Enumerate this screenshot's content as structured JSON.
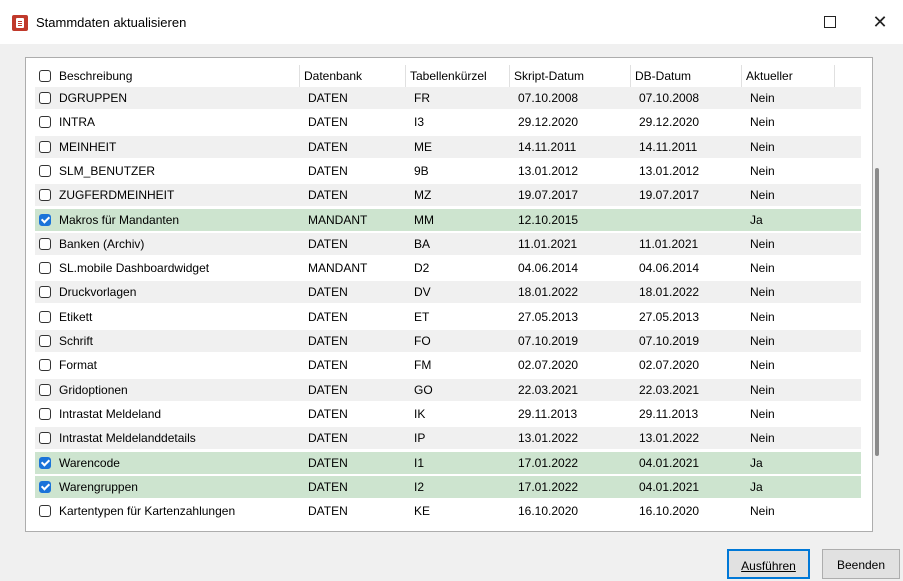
{
  "window": {
    "title": "Stammdaten aktualisieren",
    "close_glyph": "✕"
  },
  "grid": {
    "columns": [
      "Beschreibung",
      "Datenbank",
      "Tabellenkürzel",
      "Skript-Datum",
      "DB-Datum",
      "Aktueller"
    ],
    "rows": [
      {
        "checked": false,
        "beschreibung": "DGRUPPEN",
        "datenbank": "DATEN",
        "kuerzel": "FR",
        "skript": "07.10.2008",
        "db": "07.10.2008",
        "aktuell": "Nein"
      },
      {
        "checked": false,
        "beschreibung": "INTRA",
        "datenbank": "DATEN",
        "kuerzel": "I3",
        "skript": "29.12.2020",
        "db": "29.12.2020",
        "aktuell": "Nein"
      },
      {
        "checked": false,
        "beschreibung": "MEINHEIT",
        "datenbank": "DATEN",
        "kuerzel": "ME",
        "skript": "14.11.2011",
        "db": "14.11.2011",
        "aktuell": "Nein"
      },
      {
        "checked": false,
        "beschreibung": "SLM_BENUTZER",
        "datenbank": "DATEN",
        "kuerzel": "9B",
        "skript": "13.01.2012",
        "db": "13.01.2012",
        "aktuell": "Nein"
      },
      {
        "checked": false,
        "beschreibung": "ZUGFERDMEINHEIT",
        "datenbank": "DATEN",
        "kuerzel": "MZ",
        "skript": "19.07.2017",
        "db": "19.07.2017",
        "aktuell": "Nein"
      },
      {
        "checked": true,
        "beschreibung": "Makros für Mandanten",
        "datenbank": "MANDANT",
        "kuerzel": "MM",
        "skript": "12.10.2015",
        "db": "",
        "aktuell": "Ja"
      },
      {
        "checked": false,
        "beschreibung": "Banken (Archiv)",
        "datenbank": "DATEN",
        "kuerzel": "BA",
        "skript": "11.01.2021",
        "db": "11.01.2021",
        "aktuell": "Nein"
      },
      {
        "checked": false,
        "beschreibung": "SL.mobile Dashboardwidget",
        "datenbank": "MANDANT",
        "kuerzel": "D2",
        "skript": "04.06.2014",
        "db": "04.06.2014",
        "aktuell": "Nein"
      },
      {
        "checked": false,
        "beschreibung": "Druckvorlagen",
        "datenbank": "DATEN",
        "kuerzel": "DV",
        "skript": "18.01.2022",
        "db": "18.01.2022",
        "aktuell": "Nein"
      },
      {
        "checked": false,
        "beschreibung": "Etikett",
        "datenbank": "DATEN",
        "kuerzel": "ET",
        "skript": "27.05.2013",
        "db": "27.05.2013",
        "aktuell": "Nein"
      },
      {
        "checked": false,
        "beschreibung": "Schrift",
        "datenbank": "DATEN",
        "kuerzel": "FO",
        "skript": "07.10.2019",
        "db": "07.10.2019",
        "aktuell": "Nein"
      },
      {
        "checked": false,
        "beschreibung": "Format",
        "datenbank": "DATEN",
        "kuerzel": "FM",
        "skript": "02.07.2020",
        "db": "02.07.2020",
        "aktuell": "Nein"
      },
      {
        "checked": false,
        "beschreibung": "Gridoptionen",
        "datenbank": "DATEN",
        "kuerzel": "GO",
        "skript": "22.03.2021",
        "db": "22.03.2021",
        "aktuell": "Nein"
      },
      {
        "checked": false,
        "beschreibung": "Intrastat Meldeland",
        "datenbank": "DATEN",
        "kuerzel": "IK",
        "skript": "29.11.2013",
        "db": "29.11.2013",
        "aktuell": "Nein"
      },
      {
        "checked": false,
        "beschreibung": "Intrastat Meldelanddetails",
        "datenbank": "DATEN",
        "kuerzel": "IP",
        "skript": "13.01.2022",
        "db": "13.01.2022",
        "aktuell": "Nein"
      },
      {
        "checked": true,
        "beschreibung": "Warencode",
        "datenbank": "DATEN",
        "kuerzel": "I1",
        "skript": "17.01.2022",
        "db": "04.01.2021",
        "aktuell": "Ja"
      },
      {
        "checked": true,
        "beschreibung": "Warengruppen",
        "datenbank": "DATEN",
        "kuerzel": "I2",
        "skript": "17.01.2022",
        "db": "04.01.2021",
        "aktuell": "Ja"
      },
      {
        "checked": false,
        "beschreibung": "Kartentypen für Kartenzahlungen",
        "datenbank": "DATEN",
        "kuerzel": "KE",
        "skript": "16.10.2020",
        "db": "16.10.2020",
        "aktuell": "Nein"
      }
    ]
  },
  "buttons": {
    "run": "Ausführen",
    "end": "Beenden"
  },
  "colors": {
    "selected_row": "#cde4cf",
    "checkbox_checked": "#1a73d9",
    "default_button_border": "#0078d7"
  }
}
